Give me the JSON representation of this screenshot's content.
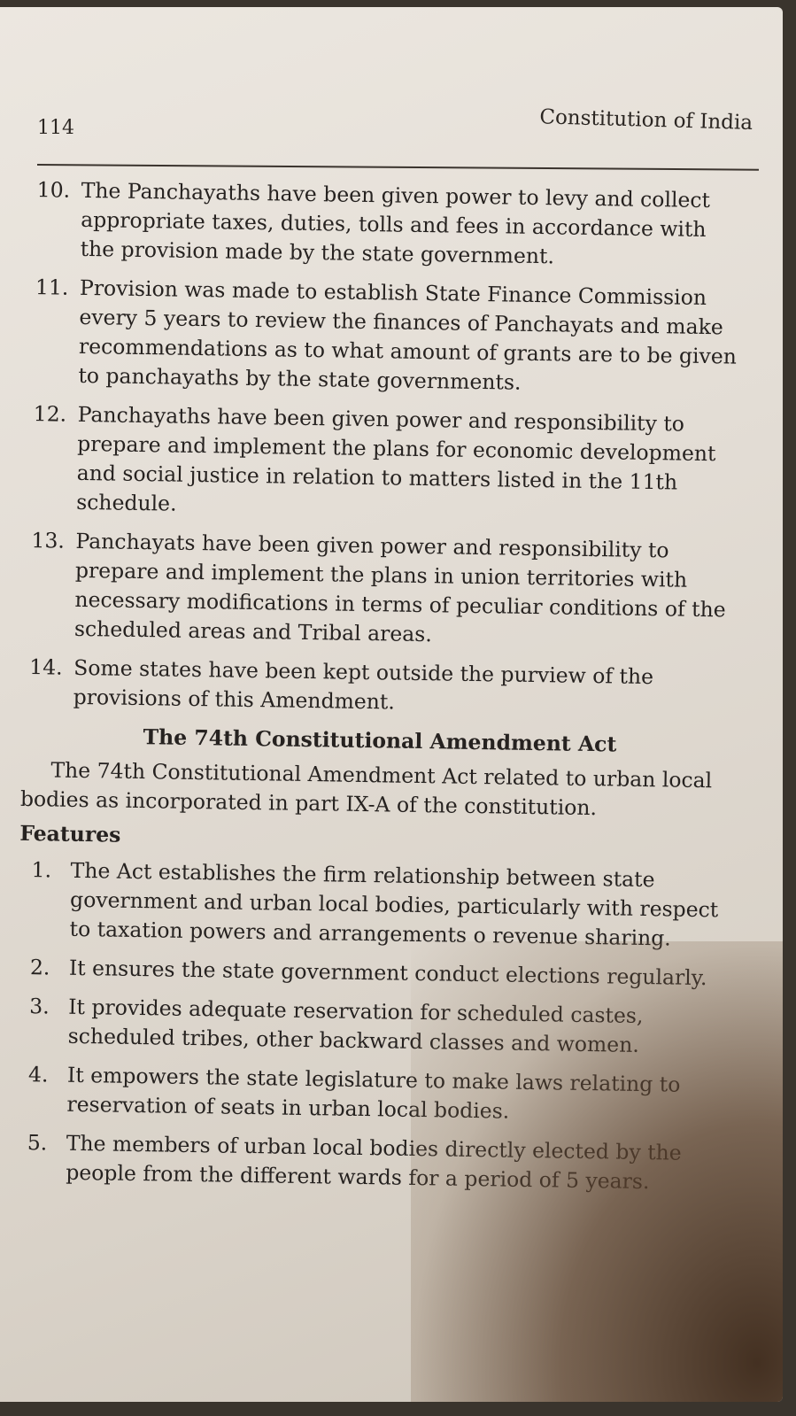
{
  "header": {
    "page_number": "114",
    "running_head": "Constitution of India"
  },
  "list_top": [
    {
      "num": "10.",
      "text": "The Panchayaths have been given power to levy and collect appropriate taxes, duties, tolls and fees in accordance with the provision made by the state government."
    },
    {
      "num": "11.",
      "text": "Provision was made to establish State Finance Commission every 5 years to review the finances of Panchayats and make recommendations as to what amount of grants are to be given to panchayaths by the state governments."
    },
    {
      "num": "12.",
      "text": "Panchayaths have been given power and responsibility to prepare and implement the plans for economic development and social justice in relation to matters listed in the 11th schedule."
    },
    {
      "num": "13.",
      "text": "Panchayats have been given power and responsibility to prepare and implement the plans in union territories with necessary modifications in terms of peculiar conditions of the scheduled areas and Tribal areas."
    },
    {
      "num": "14.",
      "text": "Some states have been kept outside the purview of the provisions of this Amendment."
    }
  ],
  "section": {
    "heading": "The 74th Constitutional Amendment Act",
    "intro": "The 74th Constitutional Amendment Act related to urban local bodies as incorporated in part IX-A of the constitution.",
    "features_label": "Features"
  },
  "features": [
    {
      "num": "1.",
      "text": "The Act establishes the firm relationship between state government and urban local bodies, particularly with respect to taxation powers and arrangements o revenue sharing."
    },
    {
      "num": "2.",
      "text": "It ensures the state government conduct elections regularly."
    },
    {
      "num": "3.",
      "text": "It provides adequate reservation for scheduled castes, scheduled tribes, other backward classes and women."
    },
    {
      "num": "4.",
      "text": "It empowers the state legislature to make laws relating to reservation of seats in urban local bodies."
    },
    {
      "num": "5.",
      "text": "The members of urban local bodies directly elected by the people from the different wards for a period of 5 years."
    }
  ]
}
